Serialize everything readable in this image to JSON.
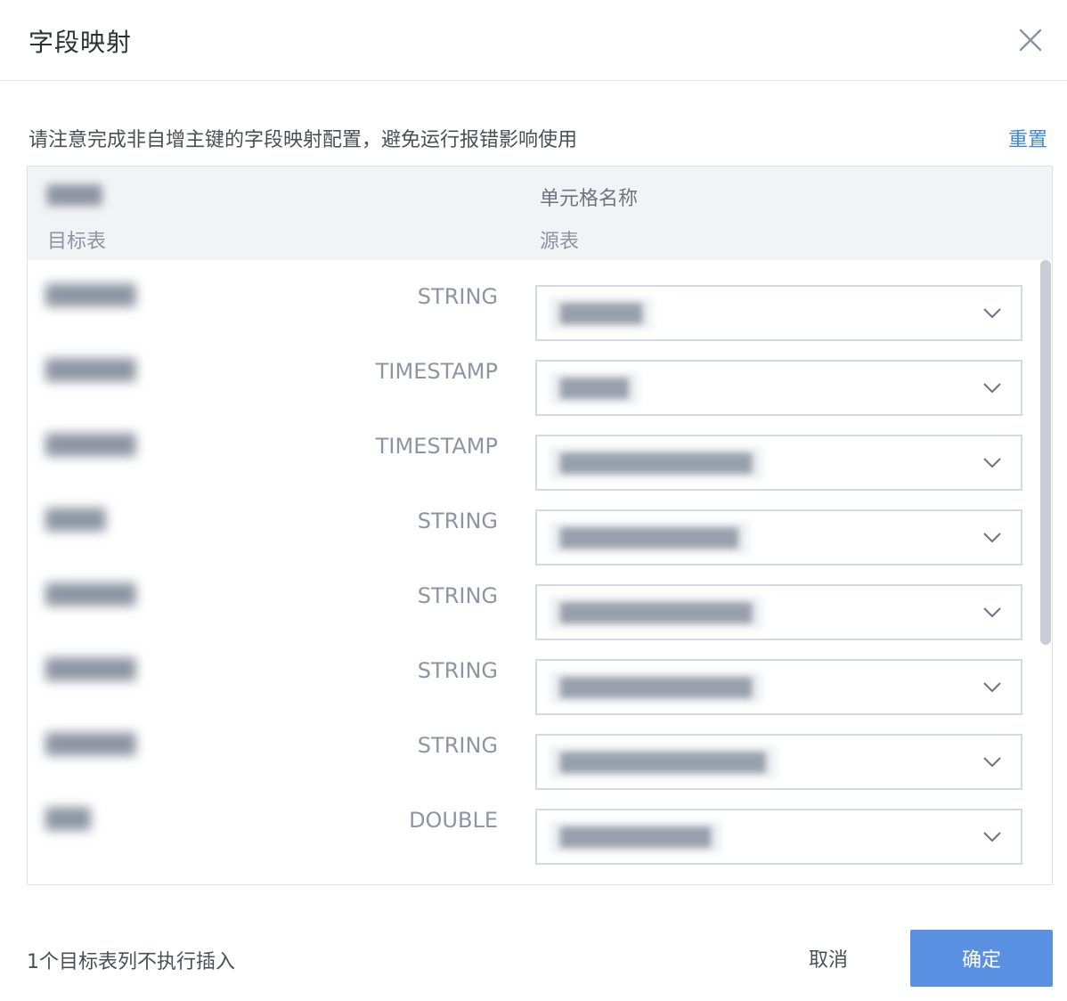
{
  "dialog": {
    "title": "字段映射",
    "close_icon": "close-icon"
  },
  "notice": {
    "text": "请注意完成非自增主键的字段映射配置，避免运行报错影响使用",
    "reset_label": "重置"
  },
  "table": {
    "header": {
      "target_name": "████",
      "target_label": "目标表",
      "source_name": "单元格名称",
      "source_label": "源表"
    },
    "rows": [
      {
        "name": "██████",
        "type": "STRING",
        "source": "██████"
      },
      {
        "name": "██████",
        "type": "TIMESTAMP",
        "source": "█████"
      },
      {
        "name": "██████",
        "type": "TIMESTAMP",
        "source": "██████████████"
      },
      {
        "name": "████",
        "type": "STRING",
        "source": "█████████████"
      },
      {
        "name": "██████",
        "type": "STRING",
        "source": "██████████████"
      },
      {
        "name": "██████",
        "type": "STRING",
        "source": "██████████████"
      },
      {
        "name": "██████",
        "type": "STRING",
        "source": "███████████████"
      },
      {
        "name": "███",
        "type": "DOUBLE",
        "source": "███████████"
      }
    ]
  },
  "footer": {
    "info": "1个目标表列不执行插入",
    "cancel_label": "取消",
    "confirm_label": "确定"
  },
  "colors": {
    "accent": "#5a90e2",
    "link": "#3f87d9",
    "header_bg": "#f1f3f7"
  }
}
